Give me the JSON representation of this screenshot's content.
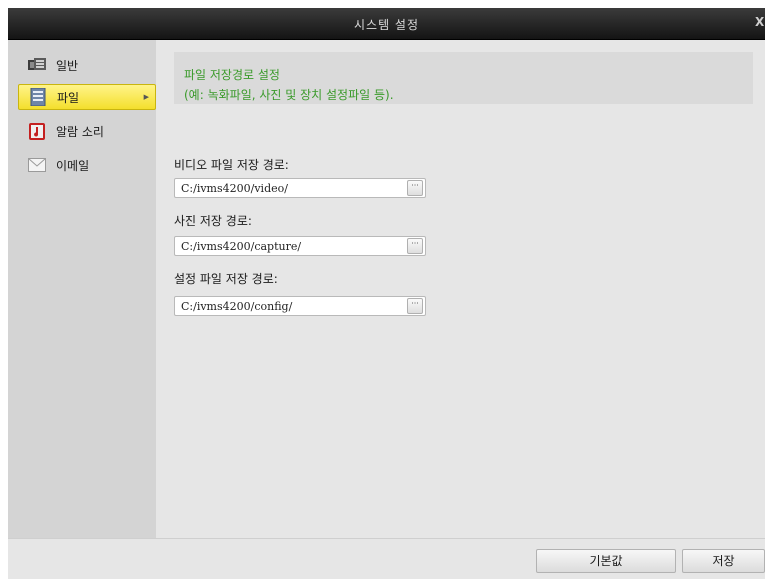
{
  "window": {
    "title": "시스템 설정",
    "close_label": "X"
  },
  "sidebar": {
    "items": [
      {
        "label": "일반",
        "icon": "monitor-icon",
        "active": false
      },
      {
        "label": "파일",
        "icon": "file-icon",
        "active": true
      },
      {
        "label": "알람 소리",
        "icon": "alarm-sound-icon",
        "active": false
      },
      {
        "label": "이메일",
        "icon": "email-icon",
        "active": false
      }
    ]
  },
  "info": {
    "line1": "파일 저장경로 설정",
    "line2": "(예: 녹화파일, 사진 및 장치 설정파일 등).",
    "color": "#3a9a2a"
  },
  "fields": [
    {
      "label": "비디오 파일 저장 경로:",
      "value": "C:/ivms4200/video/",
      "browse_label": "···"
    },
    {
      "label": "사진 저장 경로:",
      "value": "C:/ivms4200/capture/",
      "browse_label": "···"
    },
    {
      "label": "설정 파일 저장 경로:",
      "value": "C:/ivms4200/config/",
      "browse_label": "···"
    }
  ],
  "footer": {
    "default_label": "기본값",
    "save_label": "저장"
  },
  "colors": {
    "active_item": "#f4df2c",
    "titlebar": "#1e1e1e"
  }
}
